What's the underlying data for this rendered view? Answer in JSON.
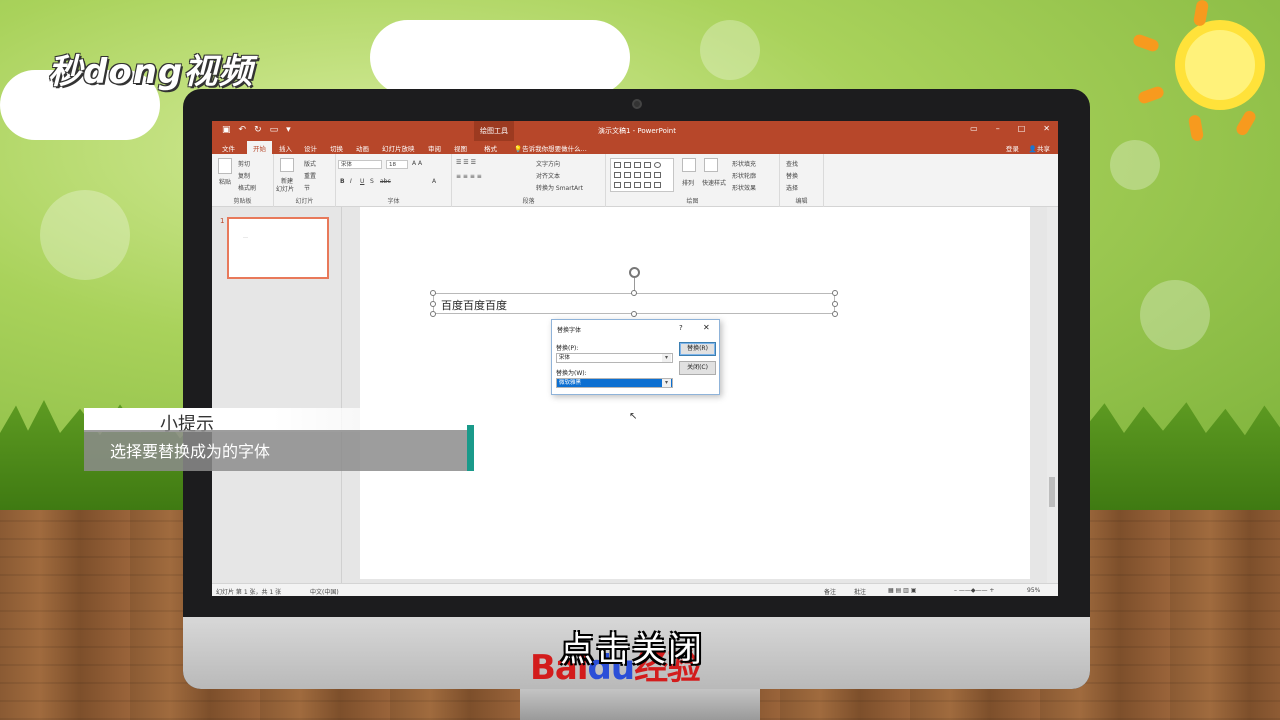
{
  "watermark": {
    "logo_text": "秒dong视频"
  },
  "app": {
    "title_context": "绘图工具",
    "doc_title": "演示文稿1 - PowerPoint",
    "tabs": [
      "文件",
      "开始",
      "插入",
      "设计",
      "切换",
      "动画",
      "幻灯片放映",
      "审阅",
      "视图",
      "格式"
    ],
    "active_tab": "开始",
    "tell_me": "告诉我你想要做什么...",
    "login": "登录",
    "share": "共享"
  },
  "ribbon": {
    "clipboard": {
      "paste": "粘贴",
      "cut": "剪切",
      "copy": "复制",
      "format_painter": "格式刷",
      "label": "剪贴板"
    },
    "slides": {
      "new_slide": "新建",
      "new_slide2": "幻灯片",
      "layout": "版式",
      "reset": "重置",
      "section": "节",
      "label": "幻灯片"
    },
    "font": {
      "font_name": "宋体",
      "font_size": "18",
      "label": "字体"
    },
    "paragraph": {
      "text_direction": "文字方向",
      "align_text": "对齐文本",
      "smartart": "转换为 SmartArt",
      "label": "段落"
    },
    "drawing": {
      "arrange": "排列",
      "quick_styles": "快速样式",
      "shape_fill": "形状填充",
      "shape_outline": "形状轮廓",
      "shape_effects": "形状效果",
      "label": "绘图"
    },
    "editing": {
      "find": "查找",
      "replace": "替换",
      "select": "选择",
      "label": "编辑"
    }
  },
  "slides_panel": {
    "number": "1",
    "thumb_text": "....."
  },
  "slide": {
    "text": "百度百度百度"
  },
  "dialog": {
    "title": "替换字体",
    "help": "?",
    "close": "✕",
    "replace_label": "替换(P):",
    "replace_value": "宋体",
    "with_label": "替换为(W):",
    "with_value": "微软雅黑",
    "replace_button": "替换(R)",
    "close_button": "关闭(C)"
  },
  "statusbar": {
    "slide_info": "幻灯片 第 1 张，共 1 张",
    "language": "中文(中国)",
    "notes": "备注",
    "comments": "批注",
    "zoom": "95%"
  },
  "tip": {
    "heading": "小提示",
    "body": "选择要替换成为的字体"
  },
  "caption": "点击关闭",
  "brand": {
    "bai": "Bai",
    "du": "du",
    "jingyan": "经验"
  }
}
